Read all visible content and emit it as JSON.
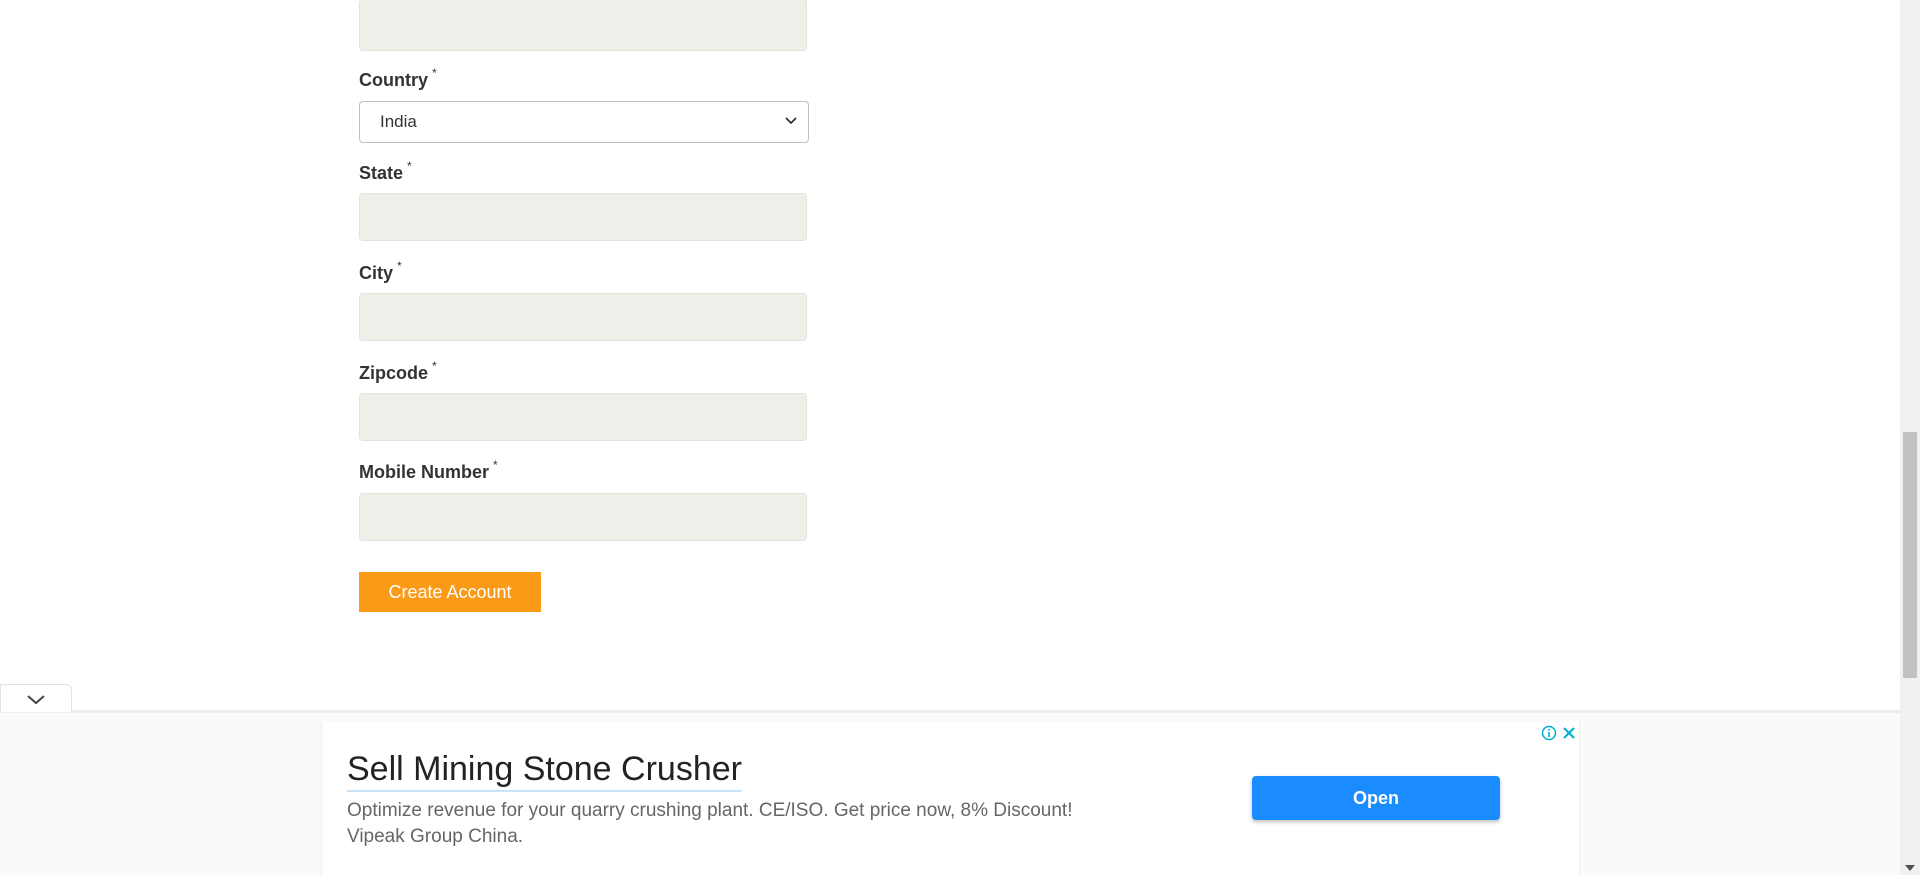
{
  "form": {
    "country_label": "Country",
    "country_value": "India",
    "state_label": "State",
    "city_label": "City",
    "zipcode_label": "Zipcode",
    "mobile_label": "Mobile Number",
    "required_mark": "*",
    "submit_label": "Create Account"
  },
  "ad": {
    "title": "Sell Mining Stone Crusher",
    "description_line1": "Optimize revenue for your quarry crushing plant. CE/ISO. Get price now, 8% Discount!",
    "description_line2": "Vipeak Group China.",
    "open_label": "Open"
  },
  "colors": {
    "accent_button": "#fa9a16",
    "ad_button": "#1a8cff",
    "input_bg": "#efeee9"
  }
}
